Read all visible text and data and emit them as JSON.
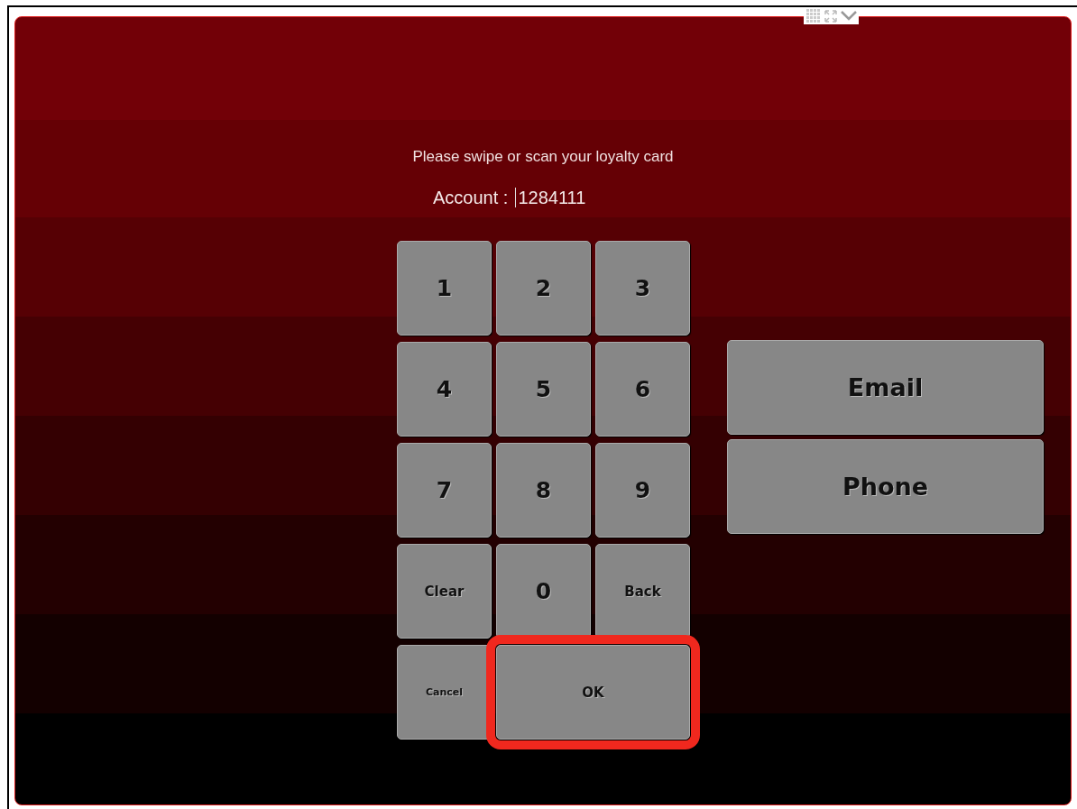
{
  "prompt": "Please swipe or scan your loyalty card",
  "account": {
    "label": "Account :",
    "value": "1284111"
  },
  "keys": [
    {
      "label": "1",
      "kind": "digit"
    },
    {
      "label": "2",
      "kind": "digit"
    },
    {
      "label": "3",
      "kind": "digit"
    },
    {
      "label": "4",
      "kind": "digit"
    },
    {
      "label": "5",
      "kind": "digit"
    },
    {
      "label": "6",
      "kind": "digit"
    },
    {
      "label": "7",
      "kind": "digit"
    },
    {
      "label": "8",
      "kind": "digit"
    },
    {
      "label": "9",
      "kind": "digit"
    },
    {
      "label": "Clear",
      "kind": "word"
    },
    {
      "label": "0",
      "kind": "digit"
    },
    {
      "label": "Back",
      "kind": "word"
    },
    {
      "label": "Cancel",
      "kind": "small"
    },
    {
      "label": "OK",
      "kind": "wide",
      "highlighted": true
    }
  ],
  "side_buttons": [
    "Email",
    "Phone"
  ]
}
